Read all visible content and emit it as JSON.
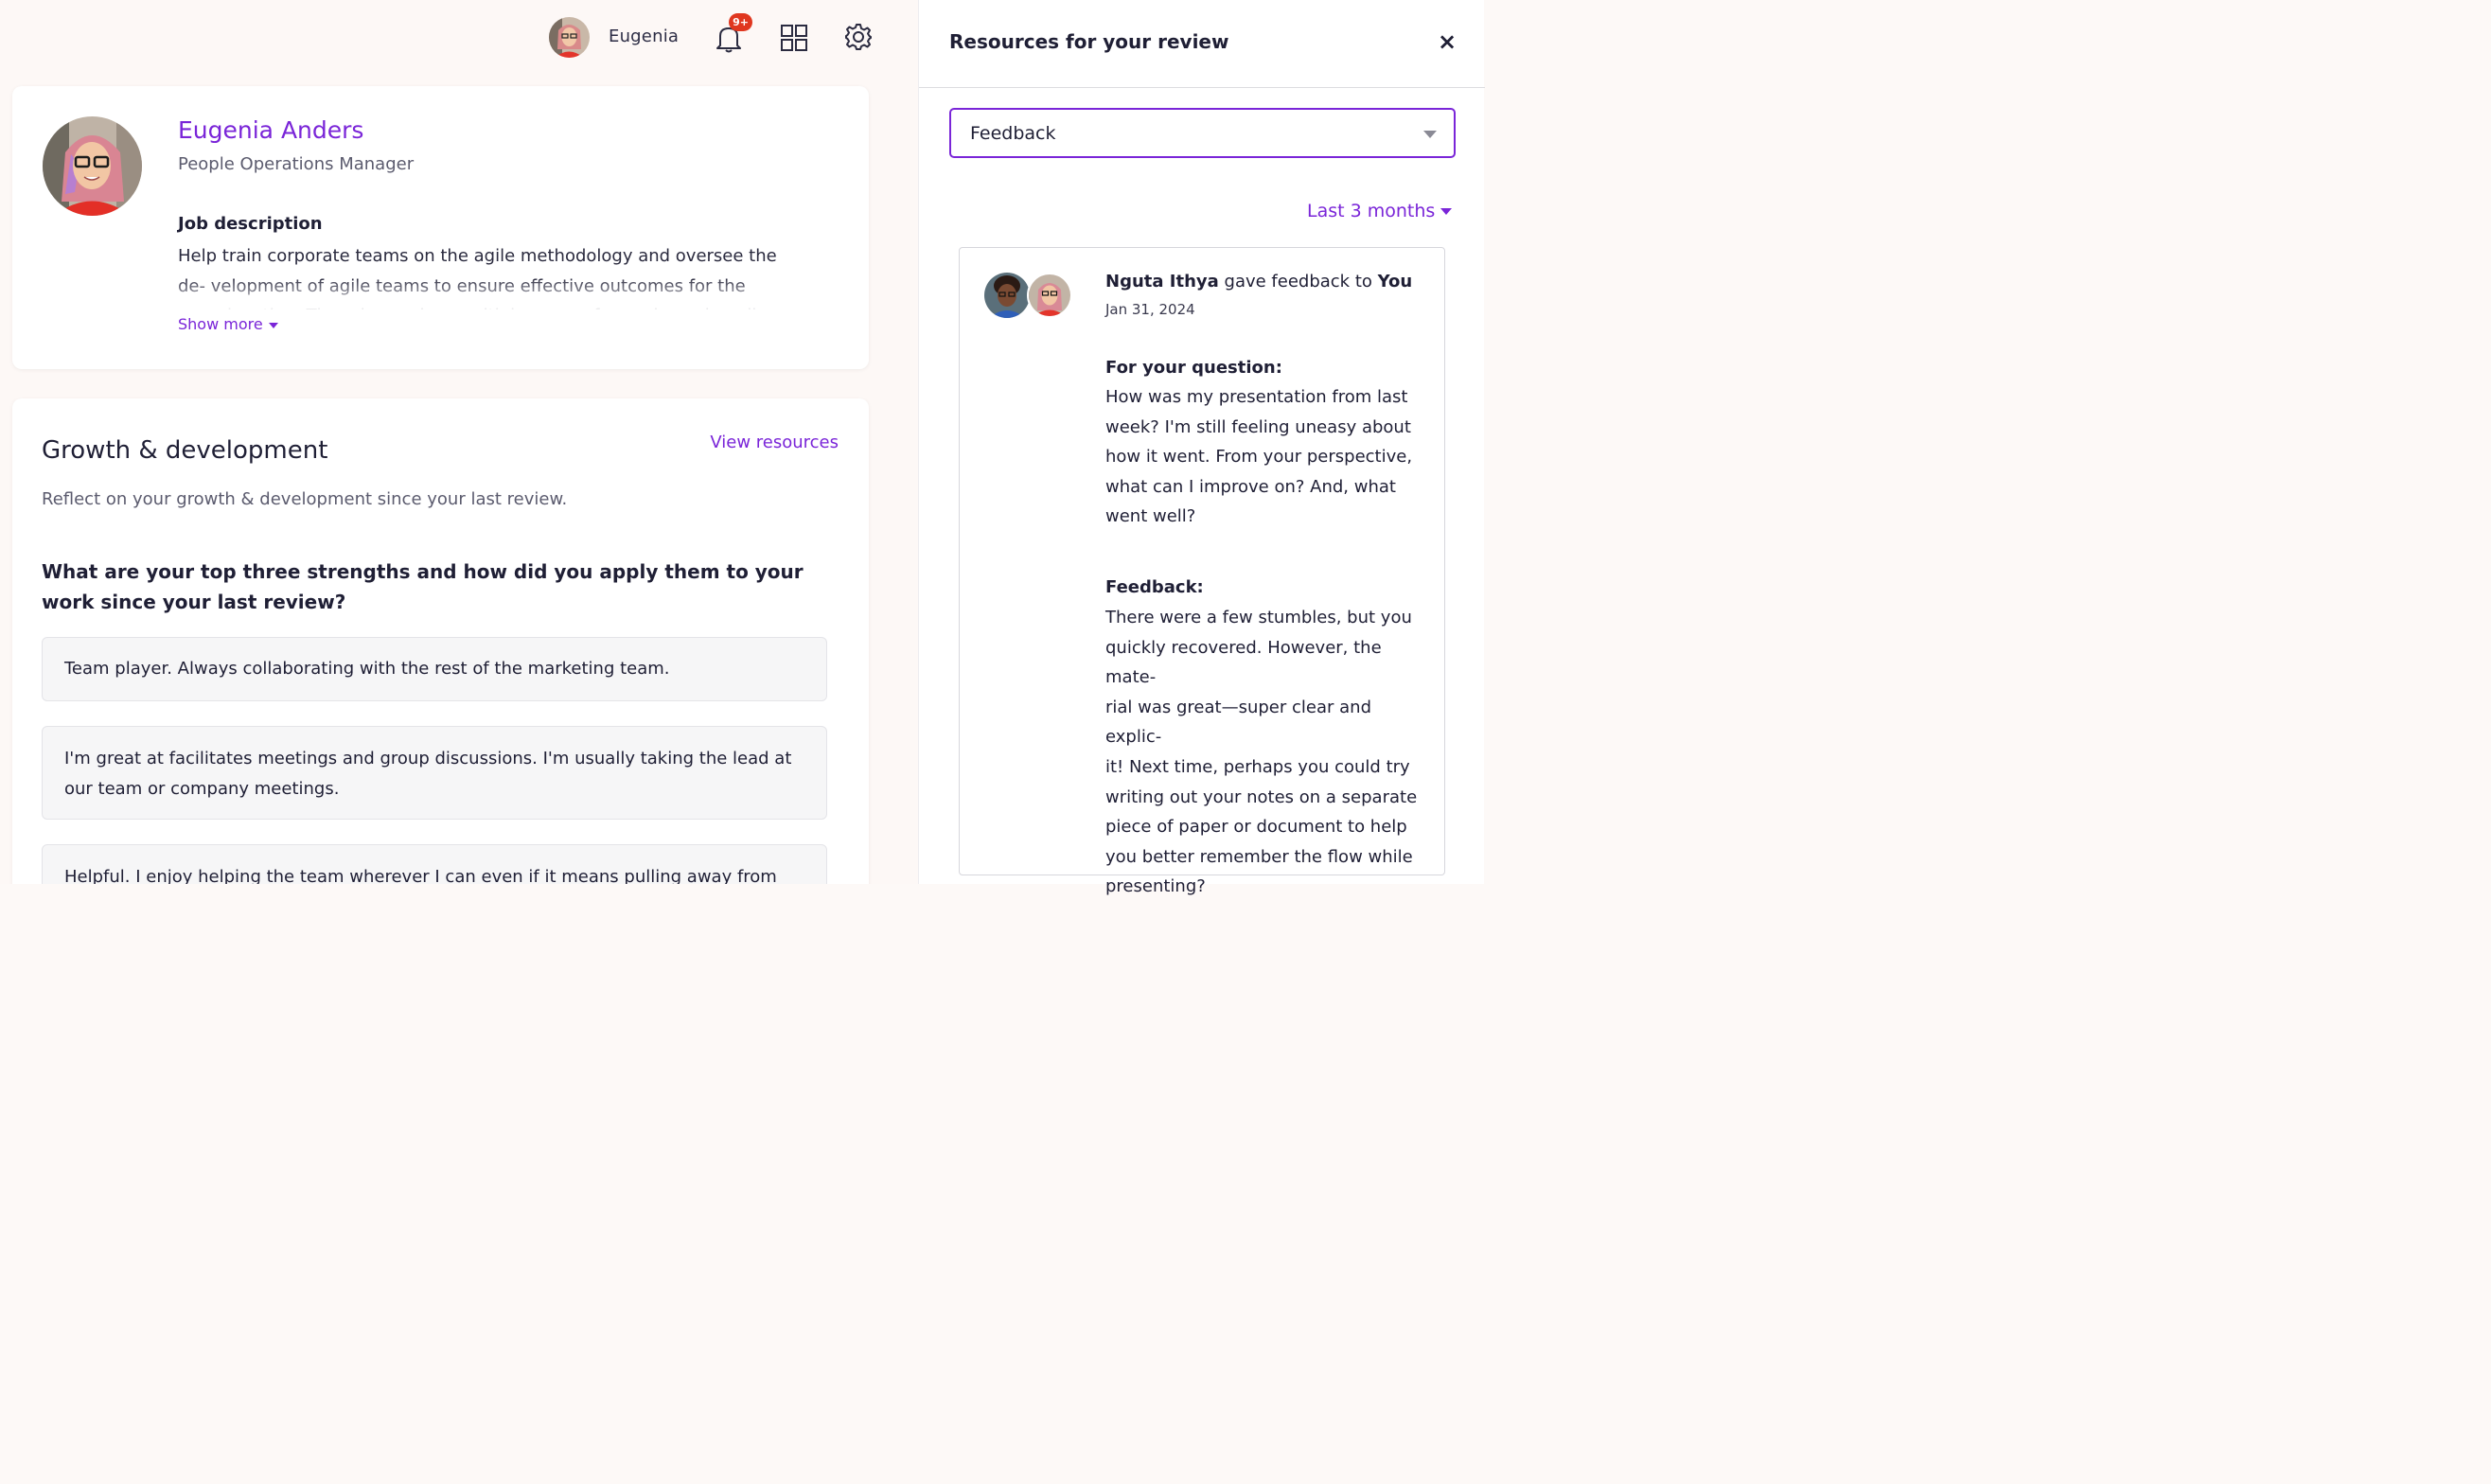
{
  "header": {
    "user_name": "Eugenia",
    "notification_badge": "9+"
  },
  "profile": {
    "name": "Eugenia Anders",
    "title": "People Operations Manager",
    "job_description_heading": "Job description",
    "job_description": "Help train corporate teams on the agile methodology and oversee the de- velopment of agile teams to ensure effective outcomes for the organiza- tion. The role requires multiple years of experience in agile practices and coaching.",
    "show_more_label": "Show more"
  },
  "growth": {
    "title": "Growth & development",
    "view_resources_label": "View resources",
    "subtitle": "Reflect on your growth & development since your last review.",
    "question": "What are your top three strengths and how did you apply them to your work since your last review?",
    "answers": [
      "Team player. Always collaborating with the rest of the marketing team.",
      "I'm great at facilitates meetings and group discussions. I'm usually taking the lead at our team or company meetings.",
      "Helpful. I enjoy helping the team wherever I can even if it means pulling away from my"
    ]
  },
  "panel": {
    "title": "Resources for your review",
    "close_label": "×",
    "select_value": "Feedback",
    "filter_label": "Last 3 months",
    "feedback": {
      "giver": "Nguta Ithya",
      "action": "gave feedback to",
      "recipient": "You",
      "date": "Jan 31, 2024",
      "question_heading": "For your question:",
      "question_text": "How was my presentation from last\nweek? I'm still feeling uneasy about\nhow it went. From your perspective,\nwhat can I improve on? And, what\nwent well?",
      "feedback_heading": "Feedback:",
      "feedback_text": "There were a few stumbles, but you\nquickly recovered. However, the mate-\nrial was great—super clear and explic-\nit! Next time, perhaps you could try\nwriting out your notes on a separate\npiece of paper or document to help\nyou better remember the flow while\npresenting?"
    }
  },
  "colors": {
    "accent": "#7a25d8",
    "badge": "#e0371f"
  }
}
